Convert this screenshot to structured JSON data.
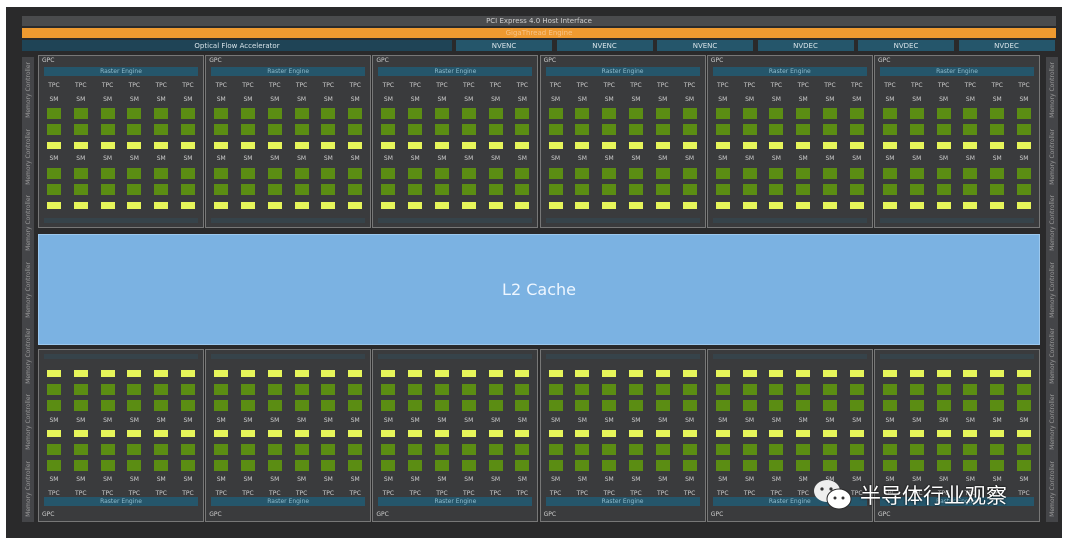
{
  "header": {
    "pcie": "PCI Express 4.0 Host Interface",
    "gigathread": "GigaThread Engine",
    "optical_flow": "Optical Flow Accelerator",
    "engines": [
      "NVENC",
      "NVENC",
      "NVENC",
      "NVDEC",
      "NVDEC",
      "NVDEC"
    ]
  },
  "memory_controller": "Memory Controller",
  "gpc": {
    "label": "GPC",
    "raster": "Raster Engine",
    "tpc": "TPC",
    "sm": "SM",
    "count_top": 6,
    "count_bottom": 6,
    "tpcs_per_gpc": 6
  },
  "l2": "L2 Cache",
  "watermark": "半导体行业观察",
  "colors": {
    "gigathread": "#ef9a30",
    "l2": "#7bb2e2",
    "sm_core": "#5b8d13",
    "rt_core": "#e6f55a",
    "raster": "#25566b"
  }
}
